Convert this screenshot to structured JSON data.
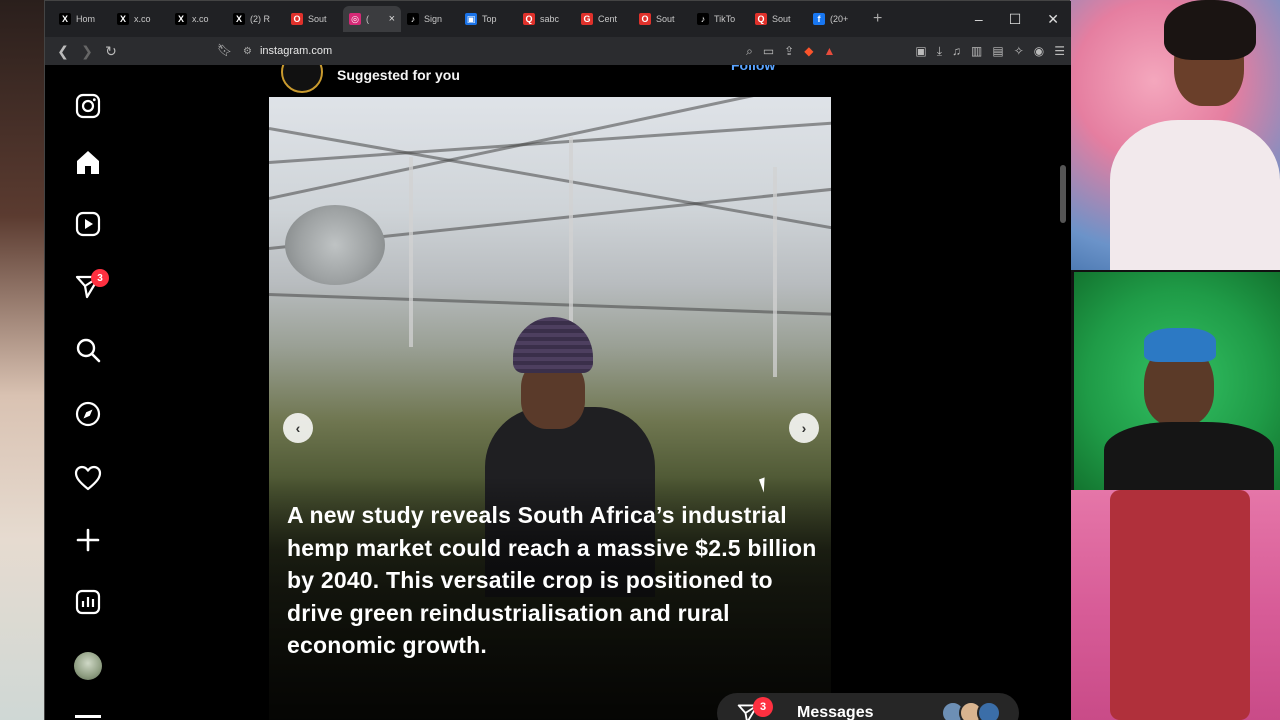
{
  "browser": {
    "tabs": [
      {
        "label": "Hom",
        "icon": "x-icon",
        "color": "#000000"
      },
      {
        "label": "x.co",
        "icon": "x-icon",
        "color": "#000000"
      },
      {
        "label": "x.co",
        "icon": "x-icon",
        "color": "#000000"
      },
      {
        "label": "(2) R",
        "icon": "x-icon",
        "color": "#000000"
      },
      {
        "label": "Sout",
        "icon": "opera-icon",
        "color": "#e0312b"
      },
      {
        "label": "(",
        "icon": "instagram-icon",
        "color": "#d62976",
        "active": true
      },
      {
        "label": "Sign",
        "icon": "tiktok-icon",
        "color": "#000000"
      },
      {
        "label": "Top",
        "icon": "generic-icon",
        "color": "#1a73e8"
      },
      {
        "label": "sabc",
        "icon": "search-icon",
        "color": "#e0312b"
      },
      {
        "label": "Cent",
        "icon": "google-icon",
        "color": "#e0312b"
      },
      {
        "label": "Sout",
        "icon": "opera-icon",
        "color": "#e0312b"
      },
      {
        "label": "TikTo",
        "icon": "tiktok-icon",
        "color": "#000000"
      },
      {
        "label": "Sout",
        "icon": "search-icon",
        "color": "#e0312b"
      },
      {
        "label": "(20+",
        "icon": "facebook-icon",
        "color": "#1877f2"
      }
    ],
    "active_tab_close": "×",
    "new_tab": "+",
    "url": "instagram.com"
  },
  "sidebar": {
    "items": [
      {
        "name": "instagram-logo",
        "icon": "instagram-icon"
      },
      {
        "name": "home",
        "icon": "home-icon"
      },
      {
        "name": "reels",
        "icon": "reels-icon"
      },
      {
        "name": "direct",
        "icon": "send-icon",
        "badge": "3"
      },
      {
        "name": "search",
        "icon": "search-icon"
      },
      {
        "name": "explore",
        "icon": "compass-icon"
      },
      {
        "name": "notifications",
        "icon": "heart-icon"
      },
      {
        "name": "create",
        "icon": "plus-icon"
      },
      {
        "name": "dashboard",
        "icon": "chart-icon"
      },
      {
        "name": "profile",
        "icon": "avatar"
      }
    ]
  },
  "post": {
    "header": "Suggested for you",
    "follow": "Follow",
    "caption": "A new study reveals South Africa’s industrial hemp market could reach a massive $2.5 billion by 2040. This versatile crop is positioned to drive green reindustrialisation and rural economic growth."
  },
  "messages": {
    "label": "Messages",
    "badge": "3"
  },
  "colors": {
    "badge": "#ff3040",
    "follow": "#5aa4ff",
    "background": "#000000"
  }
}
